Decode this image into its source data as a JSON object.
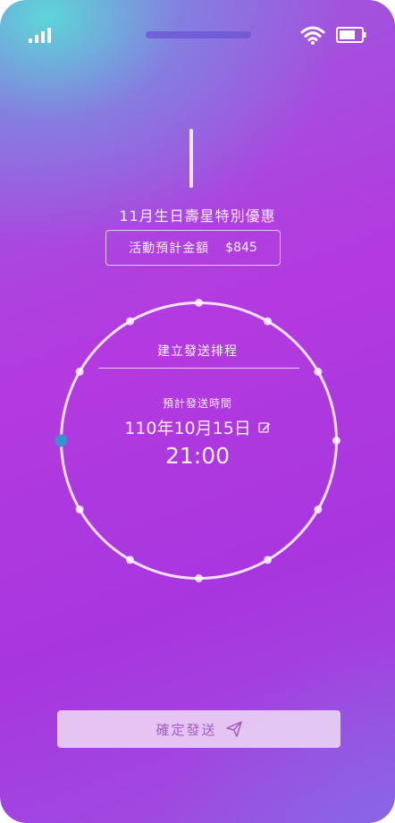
{
  "status_bar": {
    "signal_icon": "signal-icon",
    "wifi_icon": "wifi-icon",
    "battery_icon": "battery-icon"
  },
  "promo": {
    "title": "11月生日壽星特別優惠",
    "amount_label": "活動預計金額",
    "amount_value": "$845"
  },
  "schedule": {
    "title": "建立發送排程",
    "send_time_label": "預計發送時間",
    "date": "110年10月15日",
    "time": "21:00",
    "edit_icon": "edit-icon"
  },
  "footer": {
    "confirm_label": "確定發送",
    "send_icon": "paper-plane-icon"
  },
  "colors": {
    "accent_knob": "#3a8fd0",
    "button_text": "#a35cc8"
  }
}
